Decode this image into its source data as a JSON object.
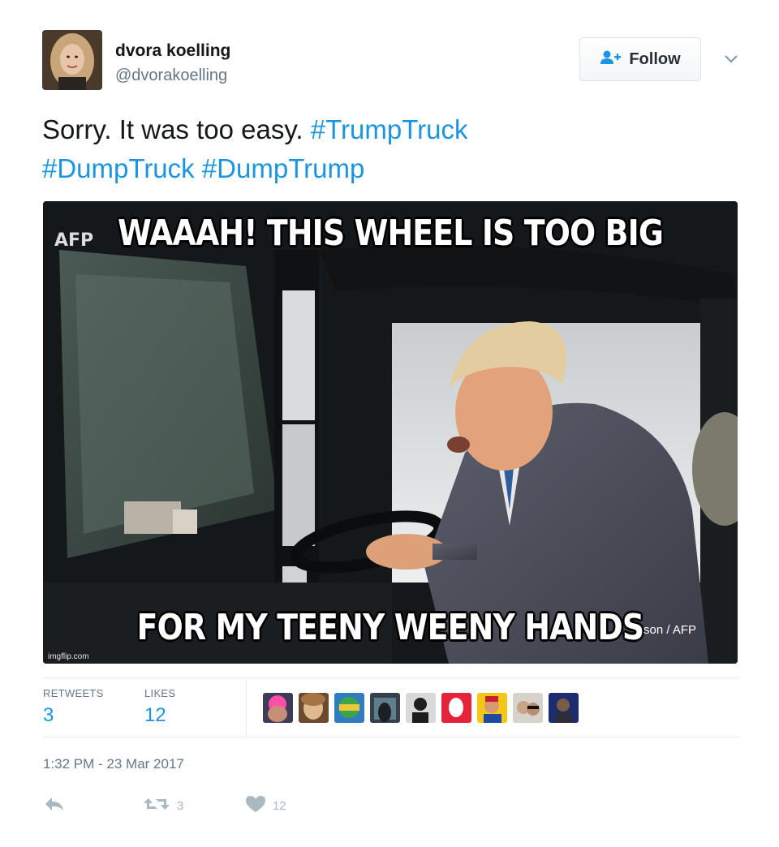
{
  "user": {
    "name": "dvora koelling",
    "handle": "@dvorakoelling"
  },
  "follow_button": {
    "label": "Follow",
    "icon": "follow-person-plus-icon"
  },
  "tweet": {
    "text_plain": "Sorry. It was too easy.",
    "hashtags": [
      "#TrumpTruck",
      "#DumpTruck",
      "#DumpTrump"
    ]
  },
  "media": {
    "top_caption": "WAAAH! THIS WHEEL IS TOO BIG",
    "bottom_caption": "FOR MY TEENY WEENY HANDS",
    "watermark_afp": "AFP",
    "watermark_imgflip": "imgflip.com",
    "photo_credit": "son / AFP"
  },
  "stats": {
    "retweets_label": "RETWEETS",
    "retweets_count": "3",
    "likes_label": "LIKES",
    "likes_count": "12"
  },
  "timestamp": "1:32 PM - 23 Mar 2017",
  "actions": {
    "reply_icon": "reply-icon",
    "retweet_icon": "retweet-icon",
    "retweet_count": "3",
    "like_icon": "heart-icon",
    "like_count": "12"
  },
  "colors": {
    "link": "#1b95e0",
    "muted": "#657786",
    "action_gray": "#aab8c2"
  }
}
